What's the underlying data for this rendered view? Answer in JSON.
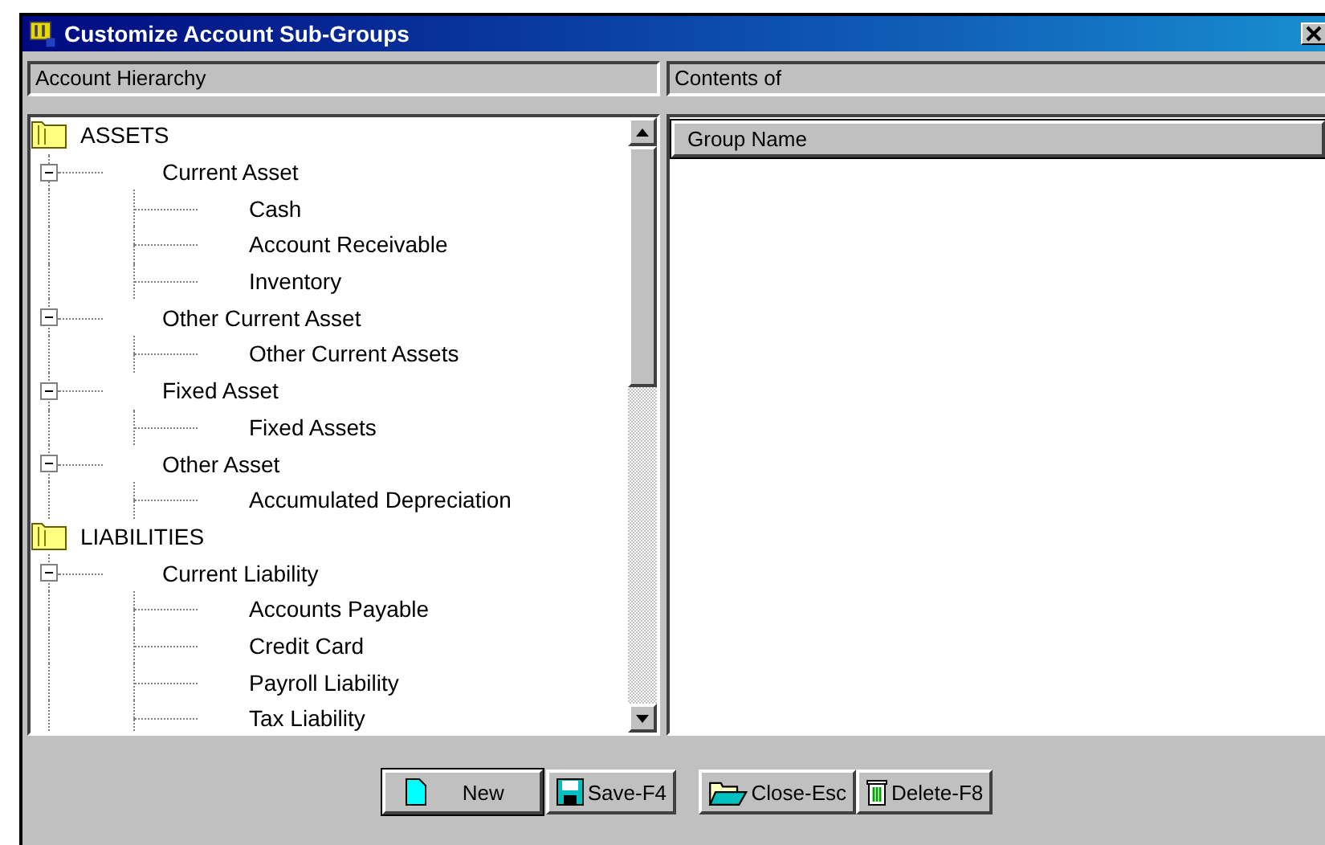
{
  "window": {
    "title": "Customize Account Sub-Groups"
  },
  "left_panel": {
    "header": "Account Hierarchy",
    "tree": [
      {
        "label": "ASSETS",
        "children": [
          {
            "label": "Current Asset",
            "expanded": true,
            "children": [
              {
                "label": "Cash"
              },
              {
                "label": "Account Receivable"
              },
              {
                "label": "Inventory"
              }
            ]
          },
          {
            "label": "Other Current Asset",
            "expanded": true,
            "children": [
              {
                "label": "Other Current Assets"
              }
            ]
          },
          {
            "label": "Fixed Asset",
            "expanded": true,
            "children": [
              {
                "label": "Fixed Assets"
              }
            ]
          },
          {
            "label": "Other Asset",
            "expanded": true,
            "children": [
              {
                "label": "Accumulated Depreciation"
              }
            ]
          }
        ]
      },
      {
        "label": "LIABILITIES",
        "children": [
          {
            "label": "Current Liability",
            "expanded": true,
            "children": [
              {
                "label": "Accounts Payable"
              },
              {
                "label": "Credit Card"
              },
              {
                "label": "Payroll Liability"
              },
              {
                "label": "Tax Liability"
              }
            ]
          }
        ]
      }
    ]
  },
  "right_panel": {
    "header": "Contents of",
    "columns": [
      "Group Name"
    ]
  },
  "buttons": [
    {
      "label": "New",
      "kind": "new",
      "default": true
    },
    {
      "label": "Save-F4",
      "kind": "save",
      "default": false
    },
    {
      "label": "Close-Esc",
      "kind": "close",
      "default": false
    },
    {
      "label": "Delete-F8",
      "kind": "delete",
      "default": false
    }
  ]
}
